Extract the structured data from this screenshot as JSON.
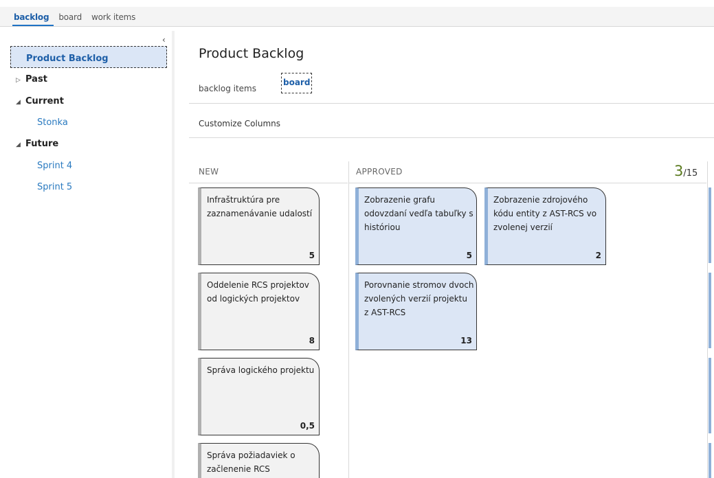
{
  "topnav": {
    "links": [
      "backlog",
      "board",
      "work items"
    ]
  },
  "sidebar": {
    "collapse_glyph": "‹",
    "items": [
      {
        "label": "Product Backlog"
      },
      {
        "label": "Past",
        "expander": "▷"
      },
      {
        "label": "Current",
        "expander": "◢"
      },
      {
        "label": "Stonka"
      },
      {
        "label": "Future",
        "expander": "◢"
      },
      {
        "label": "Sprint 4"
      },
      {
        "label": "Sprint 5"
      }
    ]
  },
  "main": {
    "title": "Product Backlog",
    "subtabs": [
      "backlog items",
      "board"
    ],
    "toolbar": {
      "customize_label": "Customize Columns"
    },
    "columns": [
      {
        "name": "NEW"
      },
      {
        "name": "APPROVED",
        "wip_current": "3",
        "wip_limit": "/15"
      }
    ],
    "cards": [
      {
        "column": "NEW",
        "title": "Infraštruktúra pre zaznamenávanie udalostí",
        "estimate": "5"
      },
      {
        "column": "NEW",
        "title": "Oddelenie RCS projektov od logických projektov",
        "estimate": "8"
      },
      {
        "column": "NEW",
        "title": "Správa logického projektu",
        "estimate": "0,5"
      },
      {
        "column": "NEW",
        "title": "Správa požiadaviek o začlenenie RCS",
        "estimate": ""
      },
      {
        "column": "APPROVED",
        "title": "Zobrazenie grafu odovzdaní vedľa tabuľky s históriou",
        "estimate": "5"
      },
      {
        "column": "APPROVED",
        "title": "Zobrazenie zdrojového kódu entity z AST-RCS vo zvolenej verzií",
        "estimate": "2"
      },
      {
        "column": "APPROVED",
        "title": "Porovnanie stromov dvoch zvolených verzií projektu z AST-RCS",
        "estimate": "13"
      }
    ]
  },
  "colors": {
    "accent": "#1e72c4",
    "link": "#2a7ac0",
    "card_blue": "#dce6f5",
    "card_gray": "#f2f2f2",
    "wip_green": "#5a7a1e"
  }
}
